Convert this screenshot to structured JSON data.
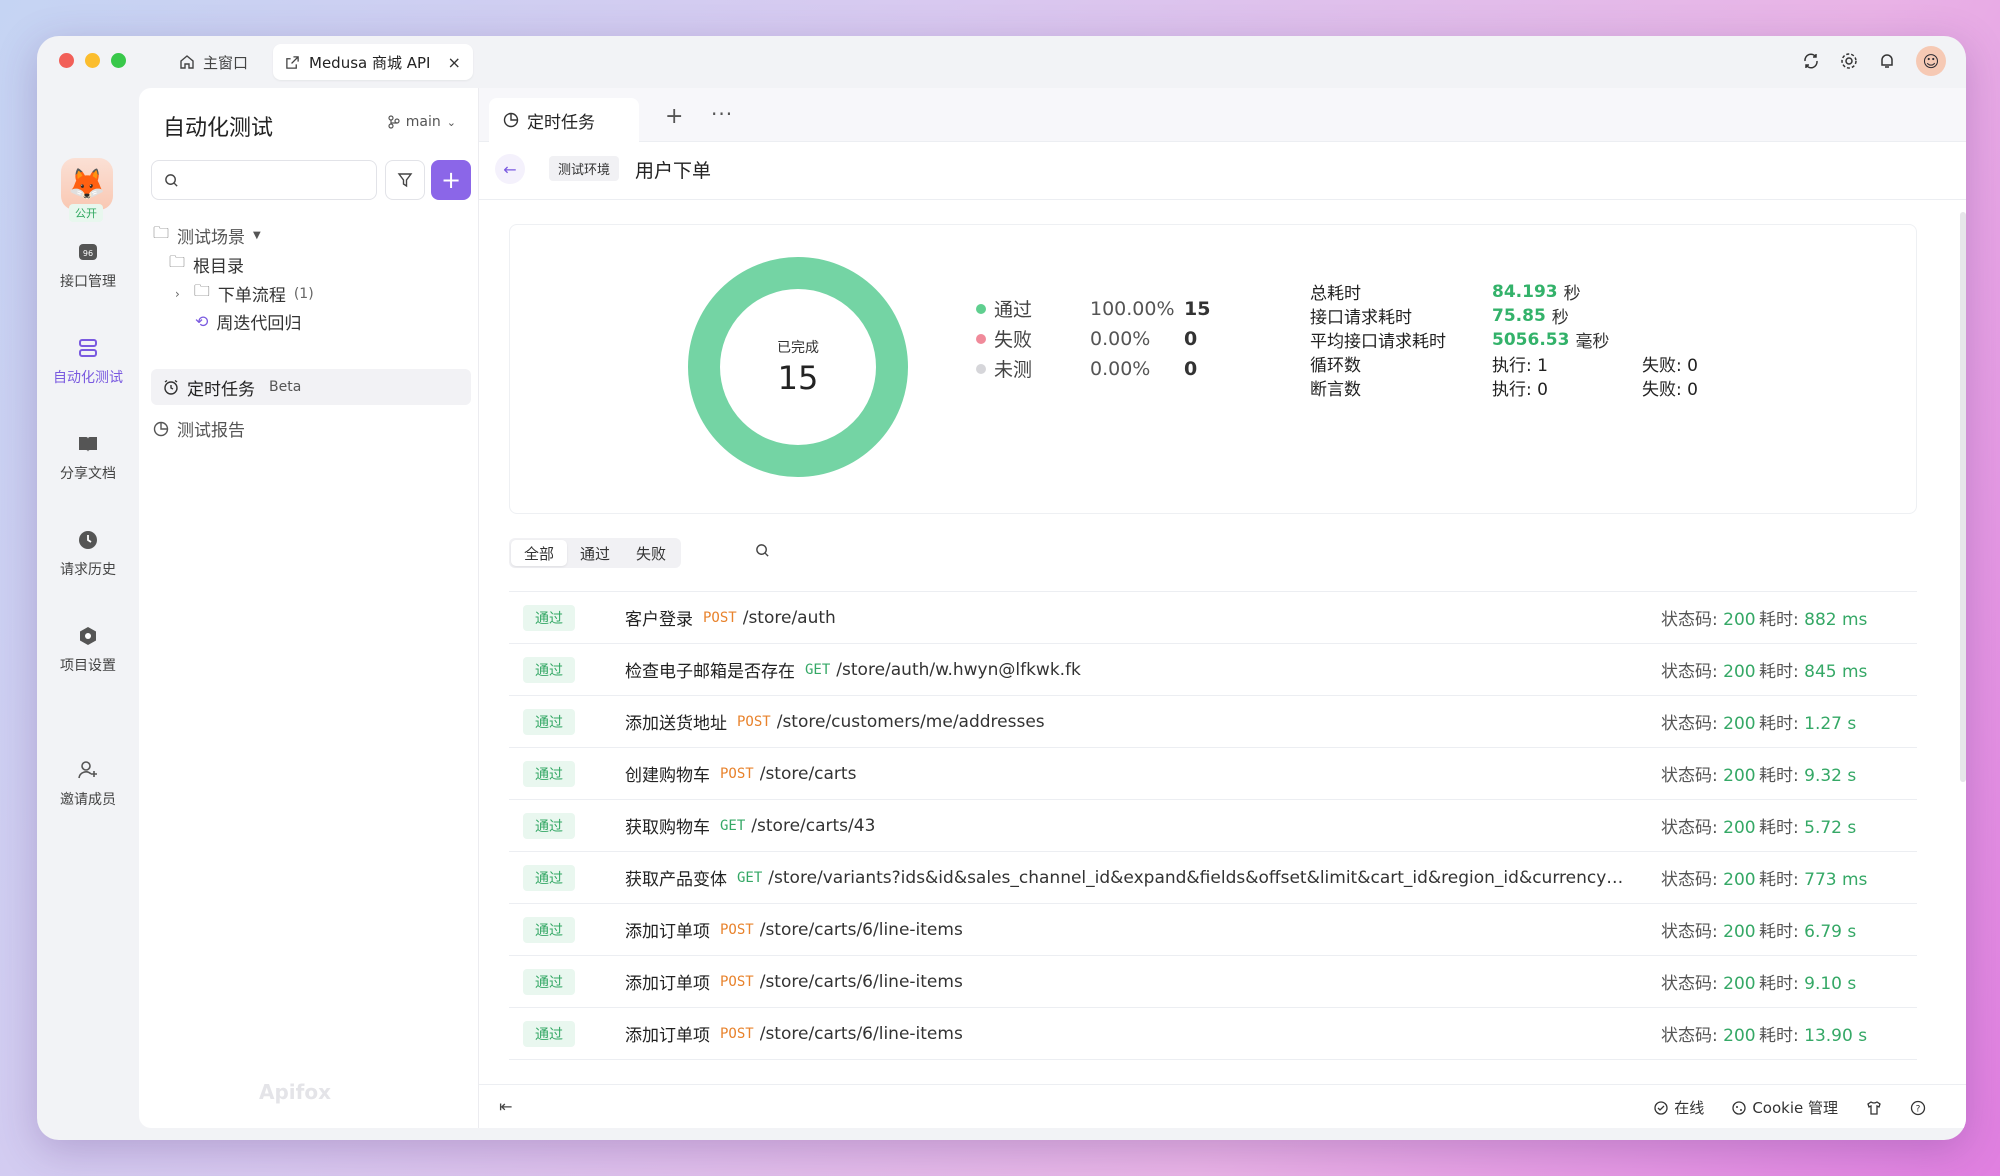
{
  "window": {
    "tabs": [
      {
        "label": "主窗口",
        "icon": "home-icon"
      },
      {
        "label": "Medusa 商城 API",
        "icon": "external-link-icon",
        "close": "×"
      }
    ],
    "toolbar_icons": [
      "sync-icon",
      "settings-icon",
      "bell-icon",
      "avatar-icon"
    ]
  },
  "rail": {
    "project_badge": "公开",
    "items": [
      {
        "label": "接口管理",
        "icon": "api-icon",
        "active": false
      },
      {
        "label": "自动化测试",
        "icon": "stack-icon",
        "active": true
      },
      {
        "label": "分享文档",
        "icon": "book-icon",
        "active": false
      },
      {
        "label": "请求历史",
        "icon": "clock-icon",
        "active": false
      },
      {
        "label": "项目设置",
        "icon": "hexagon-icon",
        "active": false
      },
      {
        "label": "邀请成员",
        "icon": "add-user-icon",
        "active": false
      }
    ]
  },
  "side": {
    "title": "自动化测试",
    "branch": "main",
    "search_placeholder": "",
    "add_label": "+",
    "tree": {
      "scenes_label": "测试场景",
      "root_label": "根目录",
      "folder_label": "下单流程",
      "folder_count": "(1)",
      "item_label": "周迭代回归",
      "schedule_label": "定时任务",
      "schedule_badge": "Beta",
      "report_label": "测试报告"
    },
    "watermark": "Apifox"
  },
  "main": {
    "tab_label": "定时任务",
    "tab_plus": "+",
    "tab_more": "···",
    "env_label": "测试环境",
    "page_title": "用户下单",
    "donut": {
      "caption": "已完成",
      "total": "15"
    },
    "legend": [
      {
        "name": "通过",
        "percent": "100.00%",
        "count": "15",
        "color": "#5fcf8f"
      },
      {
        "name": "失败",
        "percent": "0.00%",
        "count": "0",
        "color": "#f08a9a"
      },
      {
        "name": "未测",
        "percent": "0.00%",
        "count": "0",
        "color": "#d6d6da"
      }
    ],
    "stats": {
      "total_time_label": "总耗时",
      "total_time_value": "84.193",
      "total_time_unit": "秒",
      "req_time_label": "接口请求耗时",
      "req_time_value": "75.85",
      "req_time_unit": "秒",
      "avg_time_label": "平均接口请求耗时",
      "avg_time_value": "5056.53",
      "avg_time_unit": "毫秒",
      "loop_label": "循环数",
      "loop_exec": "执行: 1",
      "loop_fail": "失败: 0",
      "assert_label": "断言数",
      "assert_exec": "执行: 0",
      "assert_fail": "失败: 0"
    },
    "filters": [
      "全部",
      "通过",
      "失败"
    ],
    "status_code_label": "状态码:",
    "time_label": "耗时:",
    "rows": [
      {
        "status": "通过",
        "name": "客户登录",
        "method": "POST",
        "path": "/store/auth",
        "code": "200",
        "time": "882 ms"
      },
      {
        "status": "通过",
        "name": "检查电子邮箱是否存在",
        "method": "GET",
        "path": "/store/auth/w.hwyn@lfkwk.fk",
        "code": "200",
        "time": "845 ms"
      },
      {
        "status": "通过",
        "name": "添加送货地址",
        "method": "POST",
        "path": "/store/customers/me/addresses",
        "code": "200",
        "time": "1.27 s"
      },
      {
        "status": "通过",
        "name": "创建购物车",
        "method": "POST",
        "path": "/store/carts",
        "code": "200",
        "time": "9.32 s"
      },
      {
        "status": "通过",
        "name": "获取购物车",
        "method": "GET",
        "path": "/store/carts/43",
        "code": "200",
        "time": "5.72 s"
      },
      {
        "status": "通过",
        "name": "获取产品变体",
        "method": "GET",
        "path": "/store/variants?ids&id&sales_channel_id&expand&fields&offset&limit&cart_id&region_id&currency_co...",
        "code": "200",
        "time": "773 ms"
      },
      {
        "status": "通过",
        "name": "添加订单项",
        "method": "POST",
        "path": "/store/carts/6/line-items",
        "code": "200",
        "time": "6.79 s"
      },
      {
        "status": "通过",
        "name": "添加订单项",
        "method": "POST",
        "path": "/store/carts/6/line-items",
        "code": "200",
        "time": "9.10 s"
      },
      {
        "status": "通过",
        "name": "添加订单项",
        "method": "POST",
        "path": "/store/carts/6/line-items",
        "code": "200",
        "time": "13.90 s"
      }
    ]
  },
  "statusbar": {
    "online": "在线",
    "cookie": "Cookie 管理"
  }
}
